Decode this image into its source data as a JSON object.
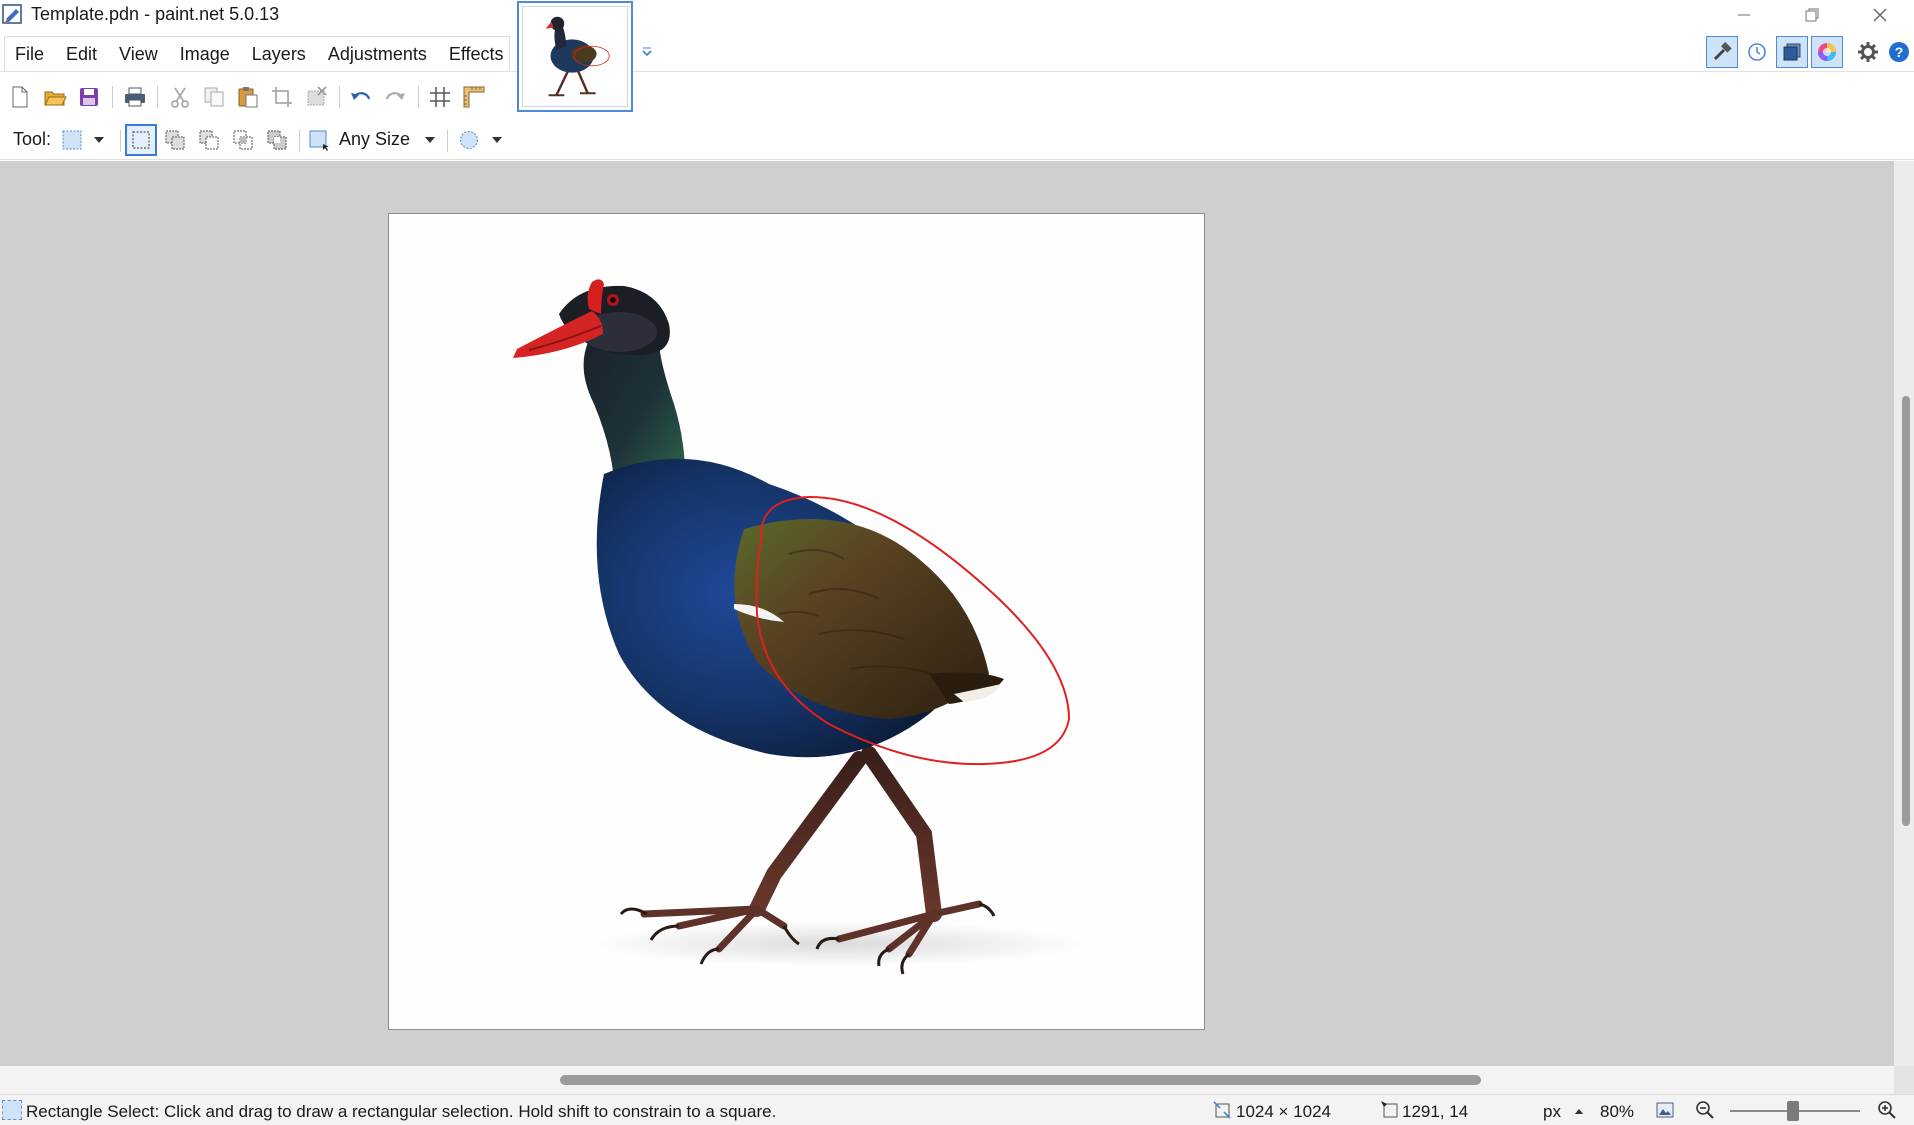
{
  "window": {
    "title": "Template.pdn - paint.net 5.0.13"
  },
  "menu": {
    "items": [
      "File",
      "Edit",
      "View",
      "Image",
      "Layers",
      "Adjustments",
      "Effects"
    ]
  },
  "toolbar": {
    "buttons": [
      "new-icon",
      "open-icon",
      "save-icon",
      "print-icon",
      "cut-icon",
      "copy-icon",
      "paste-icon",
      "crop-icon",
      "deselect-icon",
      "undo-icon",
      "redo-icon",
      "grid-icon",
      "ruler-icon"
    ]
  },
  "panels": {
    "buttons": [
      "tools-icon",
      "history-icon",
      "layers-icon",
      "colors-icon",
      "settings-icon",
      "help-icon"
    ],
    "active": [
      "tools-icon",
      "layers-icon",
      "colors-icon"
    ]
  },
  "tool_options": {
    "tool_label": "Tool:",
    "size_mode": "Any Size",
    "selection_modes": [
      "replace",
      "union",
      "exclude",
      "intersect",
      "xor"
    ],
    "active_mode": "replace"
  },
  "status": {
    "hint": "Rectangle Select: Click and drag to draw a rectangular selection. Hold shift to constrain to a square.",
    "image_size": "1024 × 1024",
    "cursor_position": "1291, 14",
    "units": "px",
    "zoom": "80%"
  },
  "colors": {
    "accent": "#4f8ad6",
    "workspace": "#cfcfcf",
    "annotation": "#e02020"
  }
}
